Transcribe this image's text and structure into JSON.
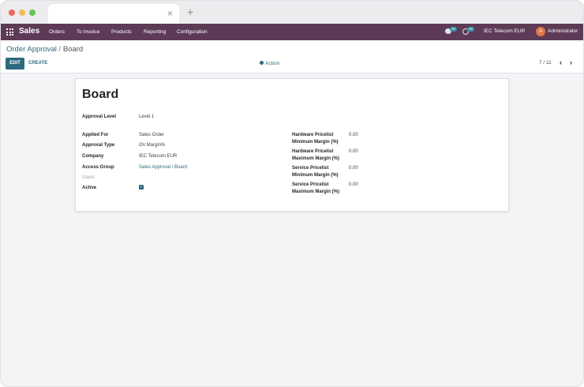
{
  "browser": {
    "close_glyph": "×",
    "newtab_glyph": "+"
  },
  "navbar": {
    "brand": "Sales",
    "menu": [
      "Orders",
      "To Invoice",
      "Products",
      "Reporting",
      "Configuration"
    ],
    "messages_count": "30",
    "activities_count": "39",
    "company": "IEC Telecom EUR",
    "user_initial": "A",
    "user": "Administrator"
  },
  "breadcrumb": {
    "parent": "Order Approval",
    "separator": "/",
    "current": "Board"
  },
  "buttons": {
    "edit": "EDIT",
    "create": "CREATE",
    "action": "Action"
  },
  "pager": {
    "value": "7 / 11",
    "prev_glyph": "‹",
    "next_glyph": "›"
  },
  "form": {
    "title": "Board",
    "approval_level": {
      "label": "Approval Level",
      "value": "Level 1"
    },
    "left": [
      {
        "label": "Applied For",
        "value": "Sales Order"
      },
      {
        "label": "Approval Type",
        "value": "On Margin%"
      },
      {
        "label": "Company",
        "value": "IEC Telecom EUR"
      },
      {
        "label": "Access Group",
        "value": "Sales Approval / Board"
      },
      {
        "label": "Users",
        "value": ""
      },
      {
        "label": "Active",
        "value": "✓"
      }
    ],
    "right": [
      {
        "label_1": "Hardware Pricelist",
        "label_2": "Minimum Margin (%)",
        "value": "0.00"
      },
      {
        "label_1": "Hardware Pricelist",
        "label_2": "Maximum Margin (%)",
        "value": "0.00"
      },
      {
        "label_1": "Service Pricelist",
        "label_2": "Minimum Margin (%)",
        "value": "0.00"
      },
      {
        "label_1": "Service Pricelist",
        "label_2": "Maximum Margin (%)",
        "value": "0.00"
      }
    ]
  },
  "colors": {
    "navbar": "#5d3b57",
    "accent": "#2c6a7e",
    "avatar": "#e1764a"
  }
}
